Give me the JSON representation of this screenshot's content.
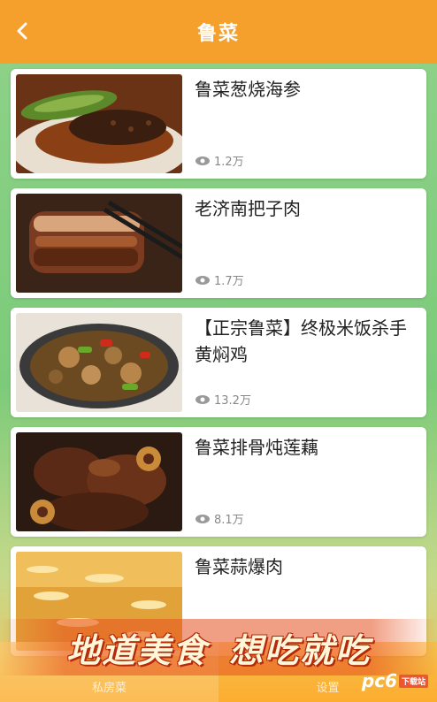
{
  "header": {
    "title": "鲁菜",
    "back_icon": "chevron-left-icon"
  },
  "recipes": [
    {
      "name": "鲁菜葱烧海参",
      "views": "1.2万"
    },
    {
      "name": "老济南把子肉",
      "views": "1.7万"
    },
    {
      "name": "【正宗鲁菜】终极米饭杀手黄焖鸡",
      "views": "13.2万"
    },
    {
      "name": "鲁菜排骨炖莲藕",
      "views": "8.1万"
    },
    {
      "name": "鲁菜蒜爆肉",
      "views": ""
    }
  ],
  "banner": {
    "part1": "地道美食",
    "part2": "想吃就吃"
  },
  "tabs": [
    {
      "label": "私房菜",
      "active": true
    },
    {
      "label": "设置",
      "active": false
    }
  ],
  "watermark": {
    "text": "pc6",
    "sub": "下载站"
  },
  "colors": {
    "header": "#f5a02c",
    "accent": "#f5a02c"
  }
}
